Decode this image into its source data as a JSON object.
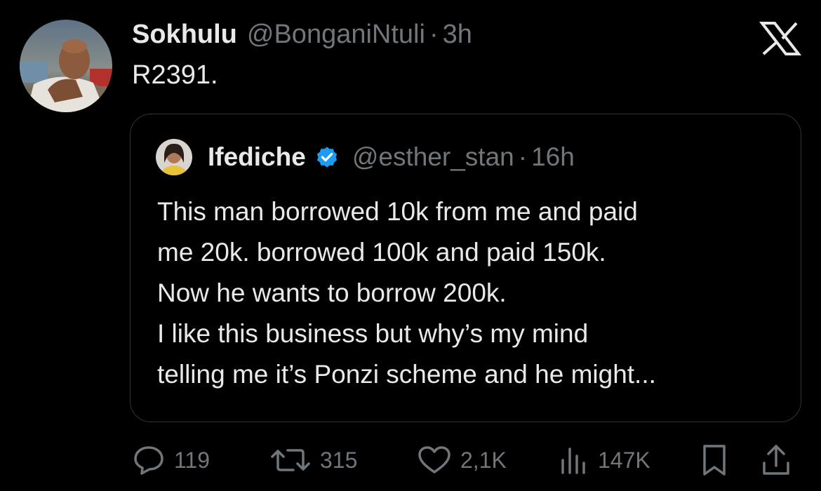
{
  "tweet": {
    "display_name": "Sokhulu",
    "handle": "@BonganiNtuli",
    "separator": "·",
    "time": "3h",
    "text": "R2391."
  },
  "quoted_tweet": {
    "display_name": "Ifediche",
    "handle": "@esther_stan",
    "separator": "·",
    "time": "16h",
    "verified": true,
    "lines": [
      "This man borrowed 10k from me and paid",
      "me 20k. borrowed 100k and paid 150k.",
      "Now he wants to borrow 200k.",
      "I like this business but why’s my mind",
      "telling me it’s Ponzi scheme and he might..."
    ]
  },
  "actions": {
    "replies": "119",
    "reposts": "315",
    "likes": "2,1K",
    "views": "147K"
  },
  "icons": {
    "close": "x-logo-icon",
    "reply": "reply-icon",
    "repost": "repost-icon",
    "like": "heart-icon",
    "views": "views-icon",
    "bookmark": "bookmark-icon",
    "share": "share-icon",
    "verified": "verified-badge-icon"
  },
  "colors": {
    "background": "#000000",
    "text": "#e7e9ea",
    "muted": "#71767b",
    "border": "#2f3336",
    "verified": "#1d9bf0"
  }
}
